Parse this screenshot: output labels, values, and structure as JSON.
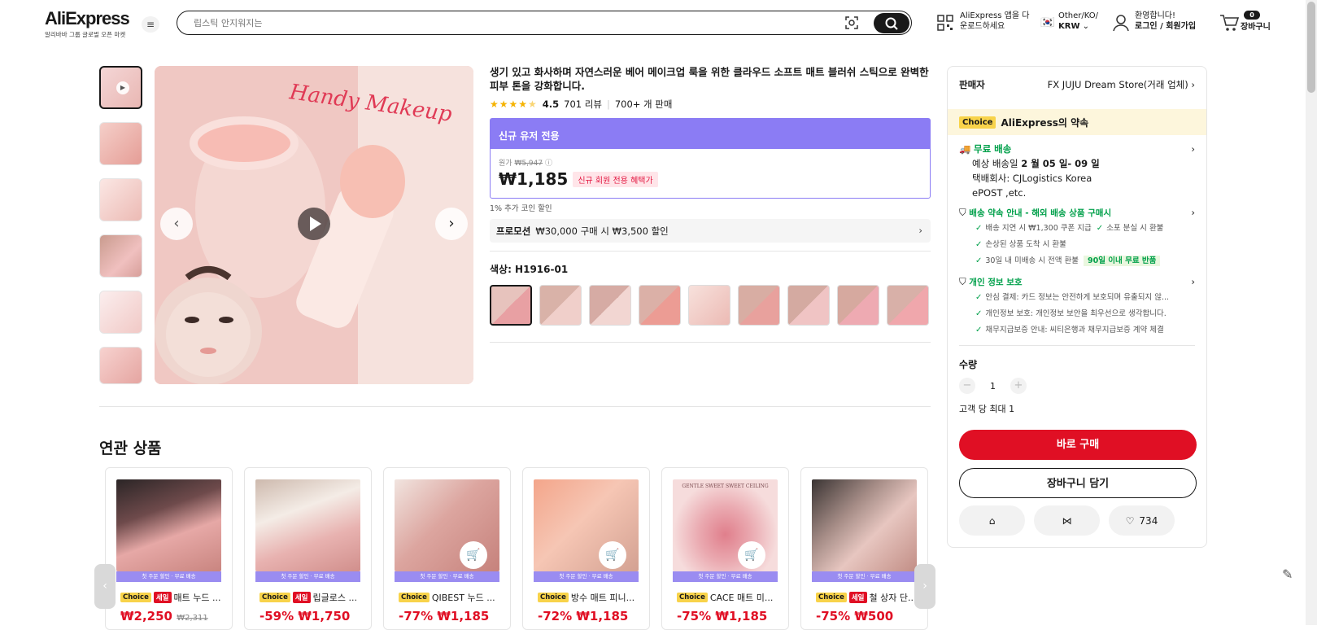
{
  "header": {
    "logo": "AliExpress",
    "logo_sub": "알리바바 그룹 글로벌 오픈 마켓",
    "search_placeholder": "립스틱 안지워지는",
    "app_line1": "AliExpress 앱을 다",
    "app_line2": "운로드하세요",
    "locale_line1": "Other/KO/",
    "locale_line2": "KRW",
    "user_line1": "환영합니다!",
    "user_line2": "로그인 / 회원가입",
    "cart_label": "장바구니",
    "cart_count": "0"
  },
  "product": {
    "title": "생기 있고 화사하며 자연스러운 베어 메이크업 룩을 위한 클라우드 소프트 매트 블러쉬 스틱으로 완벽한 피부 톤을 강화합니다.",
    "rating": "4.5",
    "rating_value": 4.5,
    "reviews": "701 리뷰",
    "sold": "700+ 개 판매",
    "promo_header": "신규 유저 전용",
    "orig_label": "원가",
    "orig_price": "₩5,947",
    "price": "₩1,185",
    "new_user_tag": "신규 회원 전용 혜택가",
    "coin": "1% 추가 코인 할인",
    "promotion_label": "프로모션",
    "promotion_text": "₩30,000 구매 시 ₩3,500 할인",
    "color_label": "색상: H1916-01",
    "image_overlay_text": "Handy Makeup"
  },
  "side": {
    "seller_label": "판매자",
    "seller_name": "FX JUJU Dream Store(거래 업체)",
    "choice_tag": "Choice",
    "choice_text": "AliExpress의 약속",
    "free_ship": "무료 배송",
    "delivery_prefix": "예상 배송일",
    "delivery_date": "2 월 05 일- 09 일",
    "carrier": "택배회사:",
    "carrier_1": "CJLogistics",
    "carrier_2": "Korea",
    "carrier_3": "ePOST ,etc.",
    "guarantee_title": "배송 약속 안내 - 해외 배송 상품 구매시",
    "g1": "배송 지연 시 ₩1,300 쿠폰 지급",
    "g2": "소포 분실 시 환불",
    "g3": "손상된 상품 도착 시 환불",
    "g4": "30일 내 미배송 시 전액 환불",
    "g4_tag": "90일 이내 무료 반품",
    "privacy_title": "개인 정보 보호",
    "p1": "안심 결제: 카드 정보는 안전하게 보호되며 유출되지 않...",
    "p2": "개인정보 보호: 개인정보 보안을 최우선으로 생각합니다.",
    "p3": "채무지급보증 안내: 씨티은행과 채무지급보증 계약 체결",
    "qty_label": "수량",
    "qty_value": "1",
    "qty_max": "고객 당 최대 1",
    "buy_now": "바로 구매",
    "add_cart": "장바구니 담기",
    "wishlist_count": "734"
  },
  "related": {
    "title": "연관 상품",
    "band_text": "첫 주문 할인 · 무료 배송",
    "items": [
      {
        "choice": "Choice",
        "sale": "세일",
        "name": "매트 누드 ...",
        "price": "₩2,250",
        "orig": "₩2,311",
        "discount": ""
      },
      {
        "choice": "Choice",
        "sale": "세일",
        "name": "립글로스 ...",
        "price": "₩1,750",
        "orig": "",
        "discount": "-59%"
      },
      {
        "choice": "Choice",
        "sale": "",
        "name": "QIBEST 누드 ...",
        "price": "₩1,185",
        "orig": "",
        "discount": "-77%"
      },
      {
        "choice": "Choice",
        "sale": "",
        "name": "방수 매트 피니...",
        "price": "₩1,185",
        "orig": "",
        "discount": "-72%"
      },
      {
        "choice": "Choice",
        "sale": "",
        "name": "CACE 매트 미...",
        "price": "₩1,185",
        "orig": "",
        "discount": "-75%",
        "img_text": "GENTLE SWEET SWEET CEILING"
      },
      {
        "choice": "Choice",
        "sale": "세일",
        "name": "철 상자 단...",
        "price": "₩500",
        "orig": "",
        "discount": "-75%"
      }
    ]
  },
  "colors": {
    "accent_red": "#e00f24",
    "promo_purple": "#8b7cf4",
    "choice_yellow": "#f8d34a",
    "green": "#00a04a"
  }
}
